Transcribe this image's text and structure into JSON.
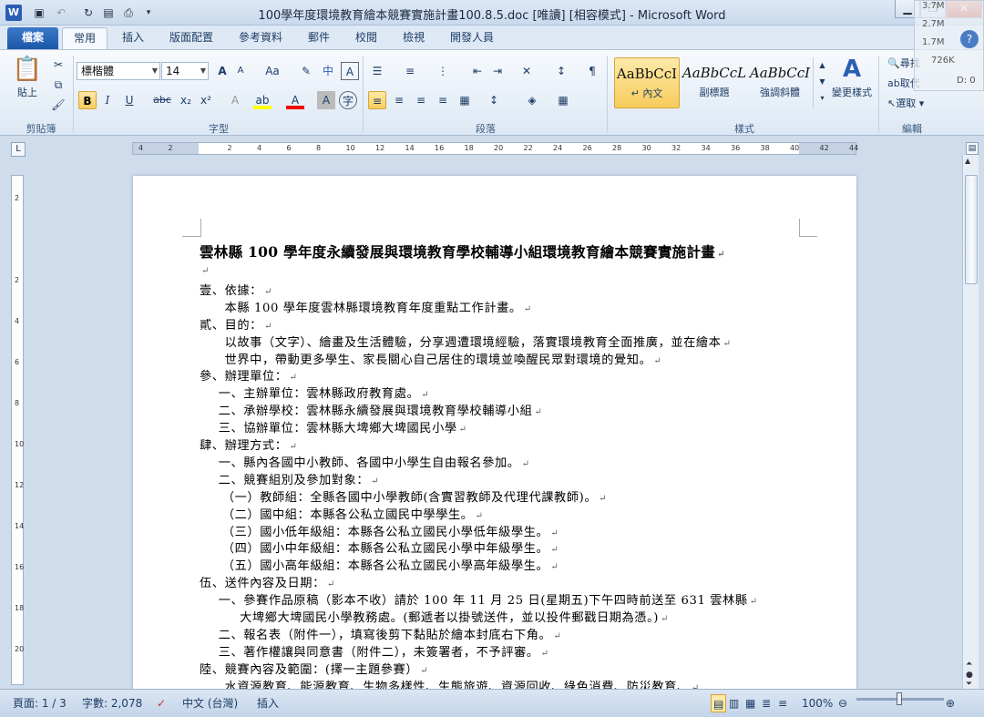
{
  "window": {
    "title": "100學年度環境教育繪本競賽實施計畫100.8.5.doc [唯讀] [相容模式] - Microsoft Word",
    "app_icon": "W"
  },
  "quick_access": {
    "save_icon": "save-icon",
    "undo_icon": "undo-icon",
    "redo_icon": "redo-icon"
  },
  "tabs": [
    "檔案",
    "常用",
    "插入",
    "版面配置",
    "參考資料",
    "郵件",
    "校閱",
    "檢視",
    "開發人員"
  ],
  "ribbon": {
    "clipboard": {
      "label": "剪貼簿",
      "paste": "貼上"
    },
    "font": {
      "label": "字型",
      "font_name": "標楷體",
      "font_size": "14",
      "bold": "B",
      "italic": "I",
      "underline": "U",
      "strike": "abc",
      "sub": "x₂",
      "sup": "x²",
      "case": "Aa",
      "grow": "A",
      "shrink": "A"
    },
    "paragraph": {
      "label": "段落"
    },
    "styles": {
      "label": "樣式",
      "items": [
        {
          "sample": "AaBbCcI",
          "name": "↵ 內文"
        },
        {
          "sample": "AaBbCcL",
          "name": "副標題"
        },
        {
          "sample": "AaBbCcI",
          "name": "強調斜體"
        }
      ],
      "change": "變更樣式"
    },
    "editing": {
      "label": "編輯",
      "find": "尋找",
      "replace": "取代",
      "select": "選取"
    }
  },
  "overlay": {
    "mem1": "3.7M",
    "mem2": "2.7M",
    "mem3": "1.7M",
    "mem4": "726K",
    "disk": "D: 0"
  },
  "document": {
    "title": "雲林縣 100 學年度永續發展與環境教育學校輔導小組環境教育繪本競賽實施計畫",
    "lines": [
      {
        "text": "",
        "indent": 0
      },
      {
        "text": "壹、依據：",
        "indent": 0
      },
      {
        "text": "本縣 100 學年度雲林縣環境教育年度重點工作計畫。",
        "indent": 2
      },
      {
        "text": "貳、目的：",
        "indent": 0
      },
      {
        "text": "以故事（文字）、繪畫及生活體驗，分享週遭環境經驗，落實環境教育全面推廣，並在繪本",
        "indent": 2
      },
      {
        "text": "世界中，帶動更多學生、家長關心自己居住的環境並喚醒民眾對環境的覺知。",
        "indent": 2
      },
      {
        "text": "參、辦理單位：",
        "indent": 0
      },
      {
        "text": "一、主辦單位：雲林縣政府教育處。",
        "indent": 1.5
      },
      {
        "text": "二、承辦學校：雲林縣永續發展與環境教育學校輔導小組",
        "indent": 1.5
      },
      {
        "text": "三、協辦單位：雲林縣大埤鄉大埤國民小學",
        "indent": 1.5
      },
      {
        "text": "肆、辦理方式：",
        "indent": 0
      },
      {
        "text": "一、縣內各國中小教師、各國中小學生自由報名參加。",
        "indent": 1.5
      },
      {
        "text": "二、競賽組別及參加對象：",
        "indent": 1.5
      },
      {
        "text": "（一）教師組：全縣各國中小學教師(含實習教師及代理代課教師)。",
        "indent": 1.8
      },
      {
        "text": "（二）國中組：本縣各公私立國民中學學生。",
        "indent": 1.8
      },
      {
        "text": "（三）國小低年級組：本縣各公私立國民小學低年級學生。",
        "indent": 1.8
      },
      {
        "text": "（四）國小中年級組：本縣各公私立國民小學中年級學生。",
        "indent": 1.8
      },
      {
        "text": "（五）國小高年級組：本縣各公私立國民小學高年級學生。",
        "indent": 1.8
      },
      {
        "text": "伍、送件內容及日期：",
        "indent": 0
      },
      {
        "text": "一、參賽作品原稿（影本不收）請於 100 年 11 月 25 日(星期五)下午四時前送至 631 雲林縣",
        "indent": 1.5
      },
      {
        "text": "大埤鄉大埤國民小學教務處。(郵遞者以掛號送件，並以投件郵戳日期為憑。)",
        "indent": 3.2
      },
      {
        "text": "二、報名表（附件一），填寫後剪下黏貼於繪本封底右下角。",
        "indent": 1.5
      },
      {
        "text": "三、著作權讓與同意書（附件二），未簽署者，不予評審。",
        "indent": 1.5
      },
      {
        "text": "陸、競賽內容及範圍：(擇一主題參賽）",
        "indent": 0
      },
      {
        "text": "水資源教育、能源教育、生物多樣性、生態旅遊、資源回收、綠色消費、防災教育、",
        "indent": 2
      }
    ]
  },
  "status": {
    "page": "頁面: 1 / 3",
    "words": "字數: 2,078",
    "language": "中文 (台灣)",
    "mode": "插入",
    "zoom": "100%"
  },
  "ruler_h": [
    "4",
    "2",
    "",
    "2",
    "4",
    "6",
    "8",
    "10",
    "12",
    "14",
    "16",
    "18",
    "20",
    "22",
    "24",
    "26",
    "28",
    "30",
    "32",
    "34",
    "36",
    "38",
    "40",
    "42",
    "44"
  ],
  "ruler_v": [
    "2",
    "",
    "2",
    "4",
    "6",
    "8",
    "10",
    "12",
    "14",
    "16",
    "18",
    "20"
  ]
}
